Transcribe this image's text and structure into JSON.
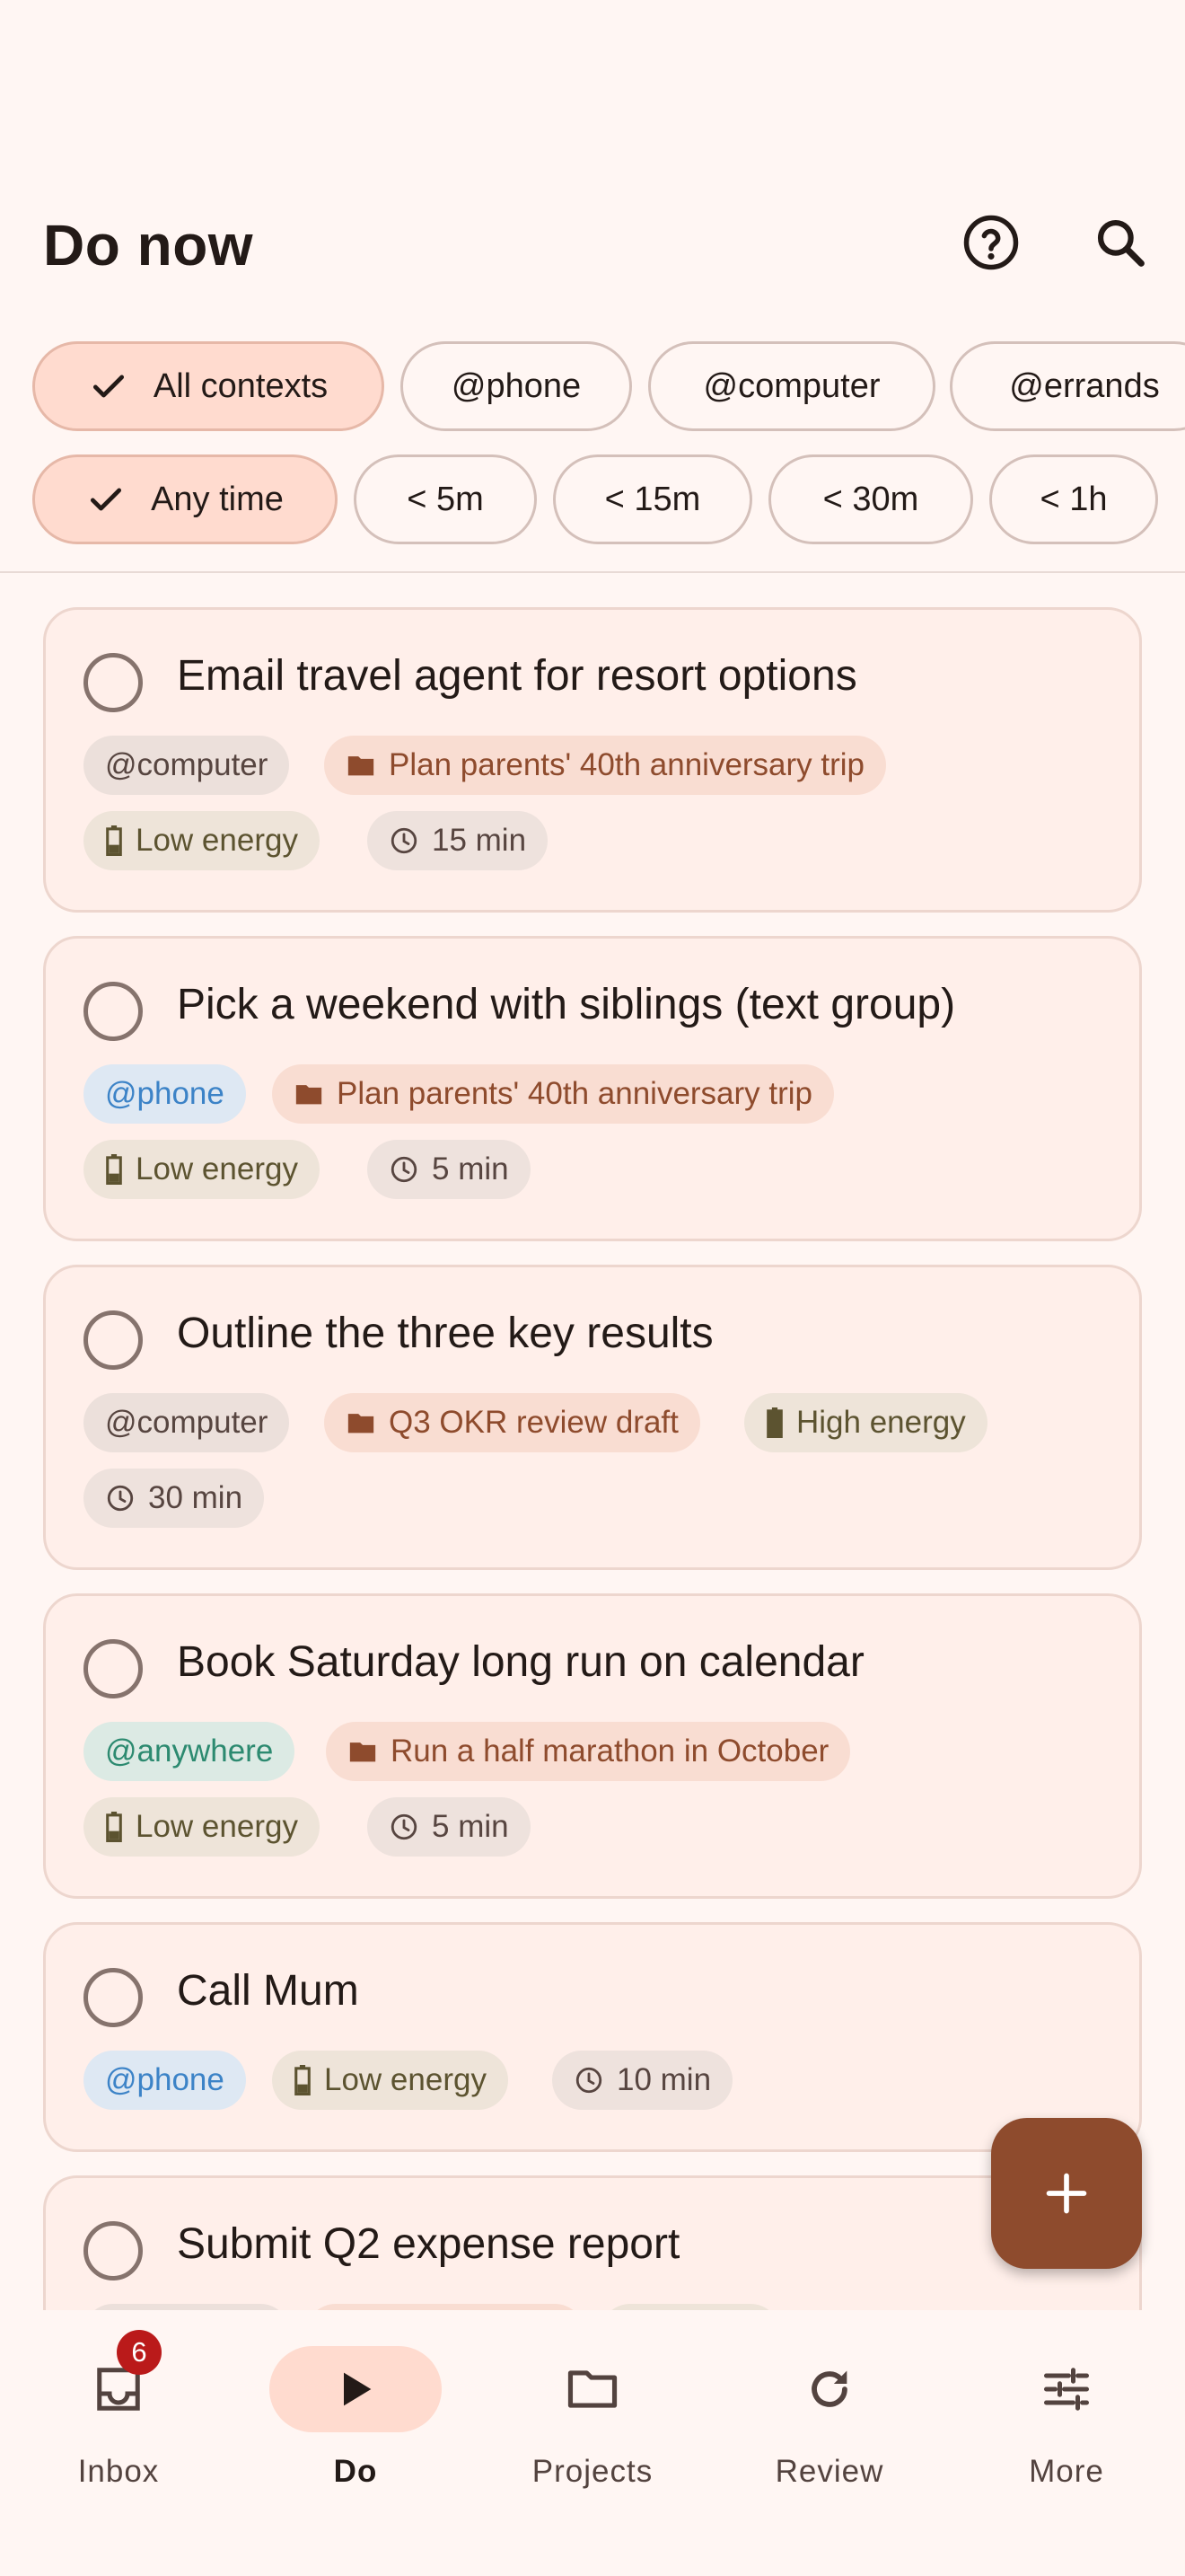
{
  "header": {
    "title": "Do now"
  },
  "context_filters": [
    {
      "label": "All contexts",
      "selected": true
    },
    {
      "label": "@phone",
      "selected": false
    },
    {
      "label": "@computer",
      "selected": false
    },
    {
      "label": "@errands",
      "selected": false
    }
  ],
  "time_filters": [
    {
      "label": "Any time",
      "selected": true
    },
    {
      "label": "< 5m",
      "selected": false
    },
    {
      "label": "< 15m",
      "selected": false
    },
    {
      "label": "< 30m",
      "selected": false
    },
    {
      "label": "< 1h",
      "selected": false
    }
  ],
  "tasks": [
    {
      "title": "Email travel agent for resort options",
      "context": "@computer",
      "project": "Plan parents' 40th anniversary trip",
      "energy": "Low energy",
      "time": "15 min"
    },
    {
      "title": "Pick a weekend with siblings (text group)",
      "context": "@phone",
      "project": "Plan parents' 40th anniversary trip",
      "energy": "Low energy",
      "time": "5 min"
    },
    {
      "title": "Outline the three key results",
      "context": "@computer",
      "project": "Q3 OKR review draft",
      "energy": "High energy",
      "time": "30 min"
    },
    {
      "title": "Book Saturday long run on calendar",
      "context": "@anywhere",
      "project": "Run a half marathon in October",
      "energy": "Low energy",
      "time": "5 min"
    },
    {
      "title": "Call Mum",
      "context": "@phone",
      "energy": "Low energy",
      "time": "10 min"
    },
    {
      "title": "Submit Q2 expense report"
    }
  ],
  "nav": {
    "inbox": {
      "label": "Inbox",
      "badge": "6"
    },
    "do": {
      "label": "Do"
    },
    "projects": {
      "label": "Projects"
    },
    "review": {
      "label": "Review"
    },
    "more": {
      "label": "More"
    }
  },
  "colors": {
    "background": "#FFF6F3",
    "accent": "#8E4B2D",
    "selected_chip": "#FFDBCF",
    "card": "#FFEFEA",
    "badge": "#BA1A1A"
  }
}
